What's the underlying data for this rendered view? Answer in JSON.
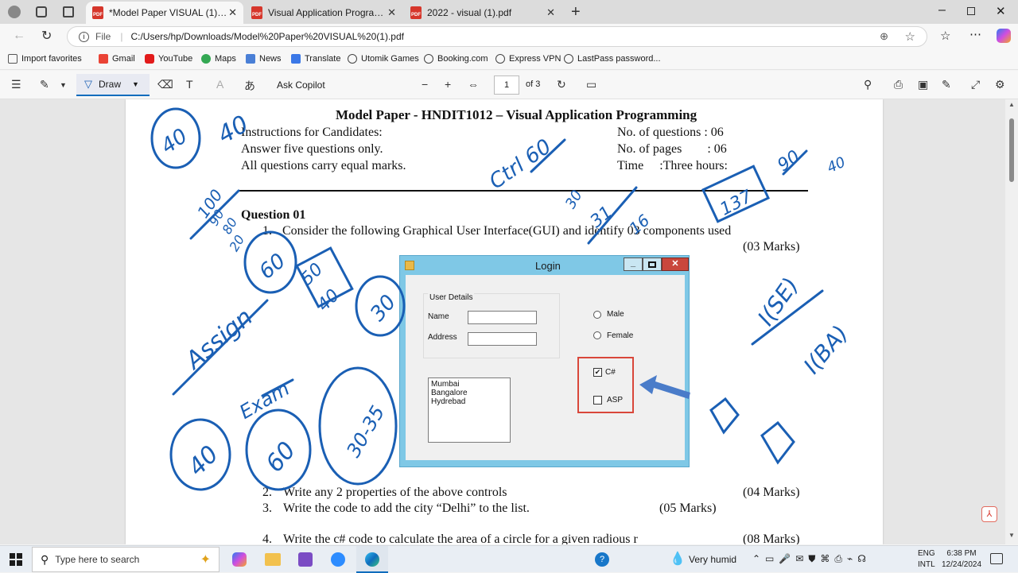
{
  "tabs": [
    {
      "label": "*Model Paper VISUAL (1).pdf",
      "active": true
    },
    {
      "label": "Visual Application Programming...",
      "active": false
    },
    {
      "label": "2022 - visual (1).pdf",
      "active": false
    }
  ],
  "address": {
    "scheme": "File",
    "url": "C:/Users/hp/Downloads/Model%20Paper%20VISUAL%20(1).pdf"
  },
  "favorites": [
    "Import favorites",
    "Gmail",
    "YouTube",
    "Maps",
    "News",
    "Translate",
    "Utomik Games",
    "Booking.com",
    "Express VPN",
    "LastPass password..."
  ],
  "pdf_toolbar": {
    "draw": "Draw",
    "ask": "Ask Copilot",
    "page": "1",
    "of": "of 3"
  },
  "paper": {
    "title": "Model Paper - HNDIT1012 – Visual Application Programming",
    "instr1": "Instructions for Candidates:",
    "instr2": "Answer five questions only.",
    "instr3": "All questions carry equal marks.",
    "meta1": "No. of  questions  : 06",
    "meta2": "No. of pages        : 06",
    "meta3": "Time     :Three hours:",
    "q_heading": "Question 01",
    "q1_num": "1.",
    "q1_text": "Consider the following Graphical User Interface(GUI) and identify 03 components used",
    "q1_marks": "(03 Marks)",
    "q2_num": "2.",
    "q2_text": "Write any 2 properties of the above controls",
    "q2_marks": "(04 Marks)",
    "q3_num": "3.",
    "q3_text": "Write the code to add the city “Delhi” to the list.",
    "q3_marks": "(05 Marks)",
    "q4_num": "4.",
    "q4_text": "Write the c# code to calculate the area of a circle for a given radious r",
    "q4_marks": "(08 Marks)"
  },
  "login": {
    "title": "Login",
    "group": "User Details",
    "name": "Name",
    "address": "Address",
    "male": "Male",
    "female": "Female",
    "csharp": "C#",
    "asp": "ASP",
    "cities": [
      "Mumbai",
      "Bangalore",
      "Hydrebad"
    ]
  },
  "ink": {
    "a": "40",
    "b": "40",
    "c": "100",
    "d": "90",
    "e": "80",
    "f": "20",
    "g": "Ctrl 60",
    "h": "30",
    "i": "31",
    "j": "16",
    "k": "137",
    "l": "90",
    "m": "40",
    "n": "Assign",
    "o": "60",
    "p": "50",
    "q": "40",
    "r": "30",
    "s": "Exam",
    "t": "40",
    "u": "60",
    "v": "30-35",
    "w": "I(SE)",
    "x": "I(BA)"
  },
  "taskbar": {
    "search": "Type here to search",
    "weather": "Very humid",
    "lang1": "ENG",
    "lang2": "INTL",
    "time": "6:38 PM",
    "date": "12/24/2024"
  },
  "colors": {
    "ink": "#1a5fb4",
    "accent": "#0f6cbd",
    "highlight": "#d9473a"
  }
}
